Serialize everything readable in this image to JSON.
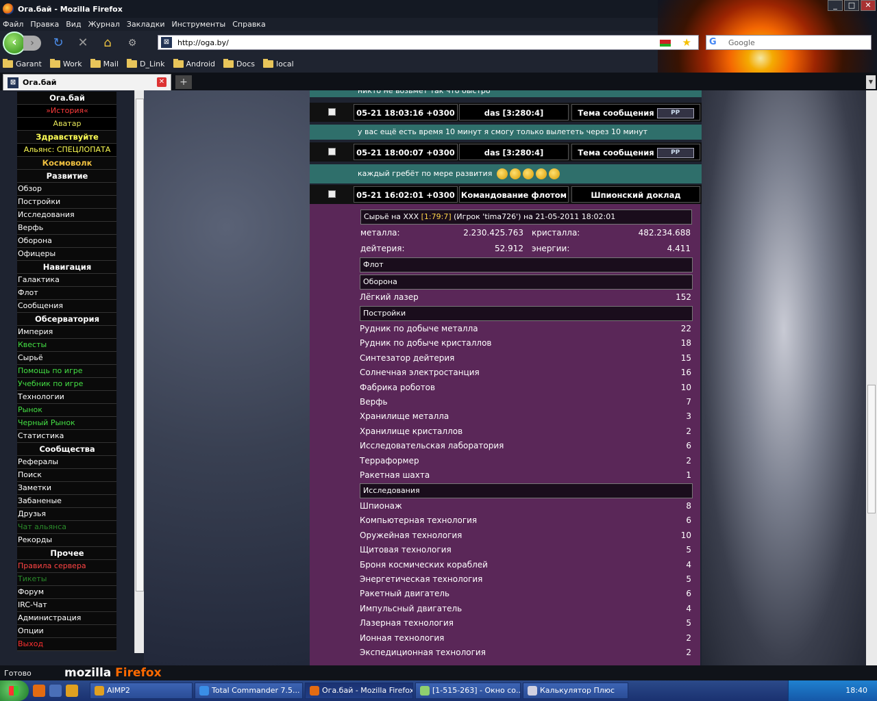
{
  "window": {
    "title": "Ога.бай - Mozilla Firefox",
    "buttons": [
      "_",
      "□",
      "✕"
    ]
  },
  "menu": [
    "Файл",
    "Правка",
    "Вид",
    "Журнал",
    "Закладки",
    "Инструменты",
    "Справка"
  ],
  "nav": {
    "url": "http://oga.by/",
    "search_placeholder": "Google"
  },
  "bookmarks": [
    "Garant",
    "Work",
    "Mail",
    "D_Link",
    "Android",
    "Docs",
    "local"
  ],
  "tab": {
    "title": "Ога.бай"
  },
  "sidebar": {
    "rows": [
      {
        "text": "Ога.бай",
        "color": "#ffffff",
        "style": "h"
      },
      {
        "text": "»История«",
        "color": "#ff3b3b",
        "style": "c"
      },
      {
        "text": "Аватар",
        "color": "#e8e85a",
        "style": "c"
      },
      {
        "text": "Здравствуйте",
        "color": "#ffff55",
        "style": "h"
      },
      {
        "text": "Альянс: СПЕЦЛОПАТА",
        "color": "#ffff55",
        "style": "c"
      },
      {
        "text": "Космоволк",
        "color": "#f0c040",
        "style": "h"
      },
      {
        "text": "Развитие",
        "color": "#ffffff",
        "style": "h"
      },
      {
        "text": "Обзор",
        "color": "#ffffff",
        "style": "lnk"
      },
      {
        "text": "Постройки",
        "color": "#ffffff",
        "style": "lnk"
      },
      {
        "text": "Исследования",
        "color": "#ffffff",
        "style": "lnk"
      },
      {
        "text": "Верфь",
        "color": "#ffffff",
        "style": "lnk"
      },
      {
        "text": "Оборона",
        "color": "#ffffff",
        "style": "lnk"
      },
      {
        "text": "Офицеры",
        "color": "#ffffff",
        "style": "lnk"
      },
      {
        "text": "Навигация",
        "color": "#ffffff",
        "style": "h"
      },
      {
        "text": "Галактика",
        "color": "#ffffff",
        "style": "lnk"
      },
      {
        "text": "Флот",
        "color": "#ffffff",
        "style": "lnk"
      },
      {
        "text": "Сообщения",
        "color": "#ffffff",
        "style": "lnk"
      },
      {
        "text": "Обсерватория",
        "color": "#ffffff",
        "style": "h"
      },
      {
        "text": "Империя",
        "color": "#ffffff",
        "style": "lnk"
      },
      {
        "text": "Квесты",
        "color": "#44e044",
        "style": "lnk"
      },
      {
        "text": "Сырьё",
        "color": "#ffffff",
        "style": "lnk"
      },
      {
        "text": "Помощь по игре",
        "color": "#44e044",
        "style": "lnk"
      },
      {
        "text": "Учебник по игре",
        "color": "#44e044",
        "style": "lnk"
      },
      {
        "text": "Технологии",
        "color": "#ffffff",
        "style": "lnk"
      },
      {
        "text": "Рынок",
        "color": "#44e044",
        "style": "lnk"
      },
      {
        "text": "Черный Рынок",
        "color": "#44e044",
        "style": "lnk"
      },
      {
        "text": "Статистика",
        "color": "#ffffff",
        "style": "lnk"
      },
      {
        "text": "Сообщества",
        "color": "#ffffff",
        "style": "h"
      },
      {
        "text": "Рефералы",
        "color": "#ffffff",
        "style": "lnk"
      },
      {
        "text": "Поиск",
        "color": "#ffffff",
        "style": "lnk"
      },
      {
        "text": "Заметки",
        "color": "#ffffff",
        "style": "lnk"
      },
      {
        "text": "Забаненые",
        "color": "#ffffff",
        "style": "lnk"
      },
      {
        "text": "Друзья",
        "color": "#ffffff",
        "style": "lnk"
      },
      {
        "text": "Чат альянса",
        "color": "#2a8a2a",
        "style": "lnk"
      },
      {
        "text": "Рекорды",
        "color": "#ffffff",
        "style": "lnk"
      },
      {
        "text": "Прочее",
        "color": "#ffffff",
        "style": "h"
      },
      {
        "text": "Правила сервера",
        "color": "#ff4444",
        "style": "lnk"
      },
      {
        "text": "Тикеты",
        "color": "#2a8a2a",
        "style": "lnk"
      },
      {
        "text": "Форум",
        "color": "#ffffff",
        "style": "lnk"
      },
      {
        "text": "IRC-Чат",
        "color": "#ffffff",
        "style": "lnk"
      },
      {
        "text": "Администрация",
        "color": "#ffffff",
        "style": "lnk"
      },
      {
        "text": "Опции",
        "color": "#ffffff",
        "style": "lnk"
      },
      {
        "text": "Выход",
        "color": "#ff3030",
        "style": "lnk"
      }
    ]
  },
  "messages": {
    "top_text": "никто не возьмет так что быстро",
    "rows": [
      {
        "date": "05-21 18:03:16 +0300",
        "from": "das [3:280:4]",
        "subject": "Тема сообщения",
        "text": "у вас ещё есть время 10 минут я смогу только вылететь через 10 минут"
      },
      {
        "date": "05-21 18:00:07 +0300",
        "from": "das [3:280:4]",
        "subject": "Тема сообщения",
        "text": "каждый гребёт по мере развития"
      },
      {
        "date": "05-21 16:02:01 +0300",
        "from": "Командование флотом",
        "subject": "Шпионский доклад",
        "text": ""
      }
    ],
    "pm_label": "PP"
  },
  "report": {
    "title_prefix": "Сырьё на XXX",
    "title_coords": "[1:79:7]",
    "title_suffix": "(Игрок 'tima726') на 21-05-2011 18:02:01",
    "resources": [
      {
        "label": "металла:",
        "value": "2.230.425.763",
        "label2": "кристалла:",
        "value2": "482.234.688"
      },
      {
        "label": "дейтерия:",
        "value": "52.912",
        "label2": "энергии:",
        "value2": "4.411"
      }
    ],
    "sections": {
      "fleet": "Флот",
      "defense": "Оборона",
      "buildings": "Постройки",
      "research": "Исследования"
    },
    "defense_items": [
      {
        "name": "Лёгкий лазер",
        "value": "152"
      }
    ],
    "building_items": [
      {
        "name": "Рудник по добыче металла",
        "value": "22"
      },
      {
        "name": "Рудник по добыче кристаллов",
        "value": "18"
      },
      {
        "name": "Синтезатор дейтерия",
        "value": "15"
      },
      {
        "name": "Солнечная электростанция",
        "value": "16"
      },
      {
        "name": "Фабрика роботов",
        "value": "10"
      },
      {
        "name": "Верфь",
        "value": "7"
      },
      {
        "name": "Хранилище металла",
        "value": "3"
      },
      {
        "name": "Хранилище кристаллов",
        "value": "2"
      },
      {
        "name": "Исследовательская лаборатория",
        "value": "6"
      },
      {
        "name": "Терраформер",
        "value": "2"
      },
      {
        "name": "Ракетная шахта",
        "value": "1"
      }
    ],
    "research_items": [
      {
        "name": "Шпионаж",
        "value": "8"
      },
      {
        "name": "Компьютерная технология",
        "value": "6"
      },
      {
        "name": "Оружейная технология",
        "value": "10"
      },
      {
        "name": "Щитовая технология",
        "value": "5"
      },
      {
        "name": "Броня космических кораблей",
        "value": "4"
      },
      {
        "name": "Энергетическая технология",
        "value": "5"
      },
      {
        "name": "Ракетный двигатель",
        "value": "6"
      },
      {
        "name": "Импульсный двигатель",
        "value": "4"
      },
      {
        "name": "Лазерная технология",
        "value": "5"
      },
      {
        "name": "Ионная технология",
        "value": "2"
      },
      {
        "name": "Экспедиционная технология",
        "value": "2"
      }
    ]
  },
  "status": {
    "text": "Готово",
    "logo_a": "mozilla",
    "logo_b": "Firefox"
  },
  "taskbar": {
    "items": [
      {
        "label": "AIMP2",
        "icon_color": "#e0a020"
      },
      {
        "label": "Total Commander 7.5...",
        "icon_color": "#3a8ee6"
      },
      {
        "label": "Ога.бай - Mozilla Firefox",
        "icon_color": "#e36b12"
      },
      {
        "label": "[1-515-263] - Окно со...",
        "icon_color": "#8fcf6f"
      },
      {
        "label": "Калькулятор Плюс",
        "icon_color": "#d0d0e0"
      }
    ],
    "clock": "18:40"
  }
}
